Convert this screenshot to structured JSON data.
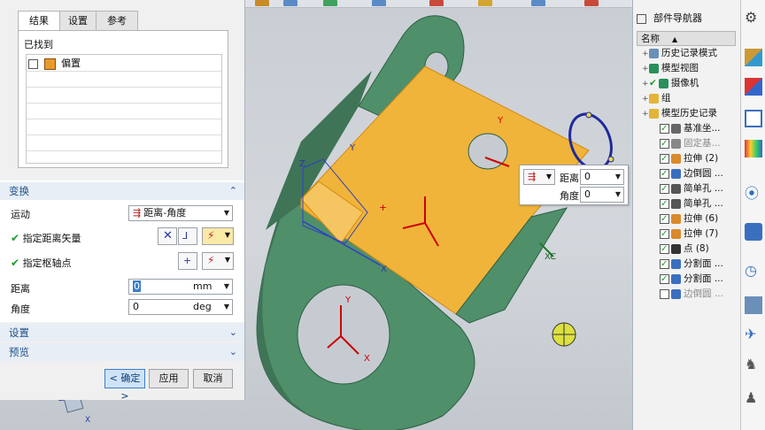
{
  "dialog": {
    "tabs": [
      "结果",
      "设置",
      "参考"
    ],
    "found_label": "已找到",
    "found_items": [
      "偏置"
    ],
    "transform_section": "变换",
    "motion_label": "运动",
    "motion_value": "距离-角度",
    "specify_vector_label": "指定距离矢量",
    "specify_pivot_label": "指定枢轴点",
    "distance_label": "距离",
    "distance_value": "0",
    "distance_unit": "mm",
    "angle_label": "角度",
    "angle_value": "0",
    "angle_unit": "deg",
    "settings_section": "设置",
    "preview_section": "预览",
    "ok_label": "< 确定 >",
    "apply_label": "应用",
    "cancel_label": "取消"
  },
  "float_input": {
    "distance_label": "距离",
    "distance_value": "0",
    "angle_label": "角度",
    "angle_value": "0"
  },
  "viewport_labels": {
    "y_hole": "Y",
    "z_left": "Z",
    "x_left": "X",
    "y_left": "Y",
    "xc": "XC",
    "y_bottom": "Y",
    "x_bottom": "X",
    "z_corner": "Z",
    "x_corner": "X"
  },
  "nav": {
    "title": "部件导航器",
    "column_name": "名称",
    "items": [
      {
        "label": "历史记录模式",
        "indent": 1,
        "checkbox": "none",
        "icon": "clock-icon"
      },
      {
        "label": "模型视图",
        "indent": 1,
        "checkbox": "none",
        "icon": "view-icon"
      },
      {
        "label": "摄像机",
        "indent": 1,
        "checkbox": "check",
        "icon": "camera-icon"
      },
      {
        "label": "组",
        "indent": 1,
        "checkbox": "none",
        "icon": "folder-icon"
      },
      {
        "label": "模型历史记录",
        "indent": 1,
        "checkbox": "none",
        "icon": "folder-icon"
      },
      {
        "label": "基准坐...",
        "indent": 2,
        "checkbox": "on",
        "icon": "datum-csys-icon"
      },
      {
        "label": "固定基...",
        "indent": 2,
        "checkbox": "on",
        "icon": "datum-plane-icon",
        "grey": true
      },
      {
        "label": "拉伸 (2)",
        "indent": 2,
        "checkbox": "on",
        "icon": "extrude-icon"
      },
      {
        "label": "边倒圆 ...",
        "indent": 2,
        "checkbox": "on",
        "icon": "edge-blend-icon"
      },
      {
        "label": "简单孔 ...",
        "indent": 2,
        "checkbox": "on",
        "icon": "hole-icon"
      },
      {
        "label": "简单孔 ...",
        "indent": 2,
        "checkbox": "on",
        "icon": "hole-icon"
      },
      {
        "label": "拉伸 (6)",
        "indent": 2,
        "checkbox": "on",
        "icon": "extrude-icon"
      },
      {
        "label": "拉伸 (7)",
        "indent": 2,
        "checkbox": "on",
        "icon": "extrude-icon"
      },
      {
        "label": "点 (8)",
        "indent": 2,
        "checkbox": "on",
        "icon": "point-icon"
      },
      {
        "label": "分割面 ...",
        "indent": 2,
        "checkbox": "on",
        "icon": "divide-face-icon"
      },
      {
        "label": "分割面 ...",
        "indent": 2,
        "checkbox": "on",
        "icon": "divide-face-icon"
      },
      {
        "label": "边倒圆 ...",
        "indent": 2,
        "checkbox": "off",
        "icon": "edge-blend-icon",
        "grey": true
      }
    ]
  },
  "colors": {
    "accent": "#1b4f8a",
    "part_green": "#4f8f6a",
    "face_orange": "#f0b43a",
    "check_green": "#1a9c2a"
  }
}
